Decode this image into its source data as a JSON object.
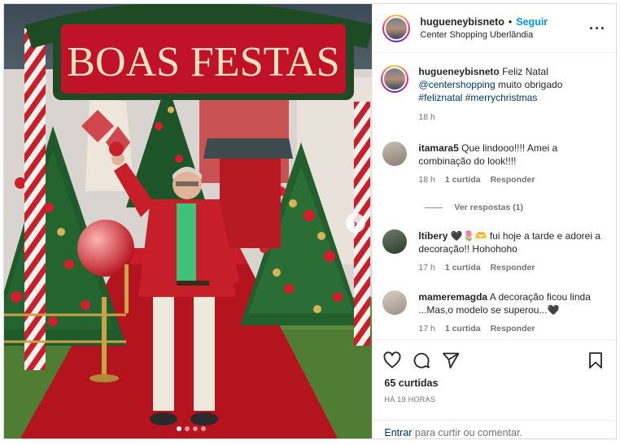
{
  "post_image": {
    "banner_text": "BOAS FESTAS",
    "carousel_dots": 4,
    "active_dot": 0
  },
  "header": {
    "username": "hugueneybisneto",
    "separator": "•",
    "follow_label": "Seguir",
    "location": "Center Shopping Uberlândia"
  },
  "caption": {
    "username": "hugueneybisneto",
    "text_intro": "Feliz Natal",
    "mention": "@centershopping",
    "text_after": "muito obrigado",
    "hashtags": "#feliznatal #merrychristmas",
    "time": "18 h"
  },
  "comments": [
    {
      "username": "itamara5",
      "text": "Que lindooo!!!! Amei a combinação do look!!!!",
      "time": "18 h",
      "likes": "1 curtida",
      "reply": "Responder"
    },
    {
      "username": "ltibery",
      "text": "🖤🌷🫶 fui hoje a tarde e adorei a decoração!! Hohohoho",
      "time": "17 h",
      "likes": "1 curtida",
      "reply": "Responder"
    },
    {
      "username": "mameremagda",
      "text": "A decoração ficou linda ...Mas,o modelo se superou...🖤",
      "time": "17 h",
      "likes": "1 curtida",
      "reply": "Responder"
    }
  ],
  "view_replies": "Ver respostas (1)",
  "likes_count": "65 curtidas",
  "posted_ago": "HÁ 19 HORAS",
  "login_prompt": {
    "link": "Entrar",
    "text": "para curtir ou comentar."
  },
  "colors": {
    "accent": "#0095f6",
    "link": "#00376b",
    "muted": "#737373"
  },
  "icons": [
    "heart-icon",
    "comment-icon",
    "share-icon",
    "bookmark-icon",
    "more-options-icon",
    "chevron-right-icon"
  ]
}
